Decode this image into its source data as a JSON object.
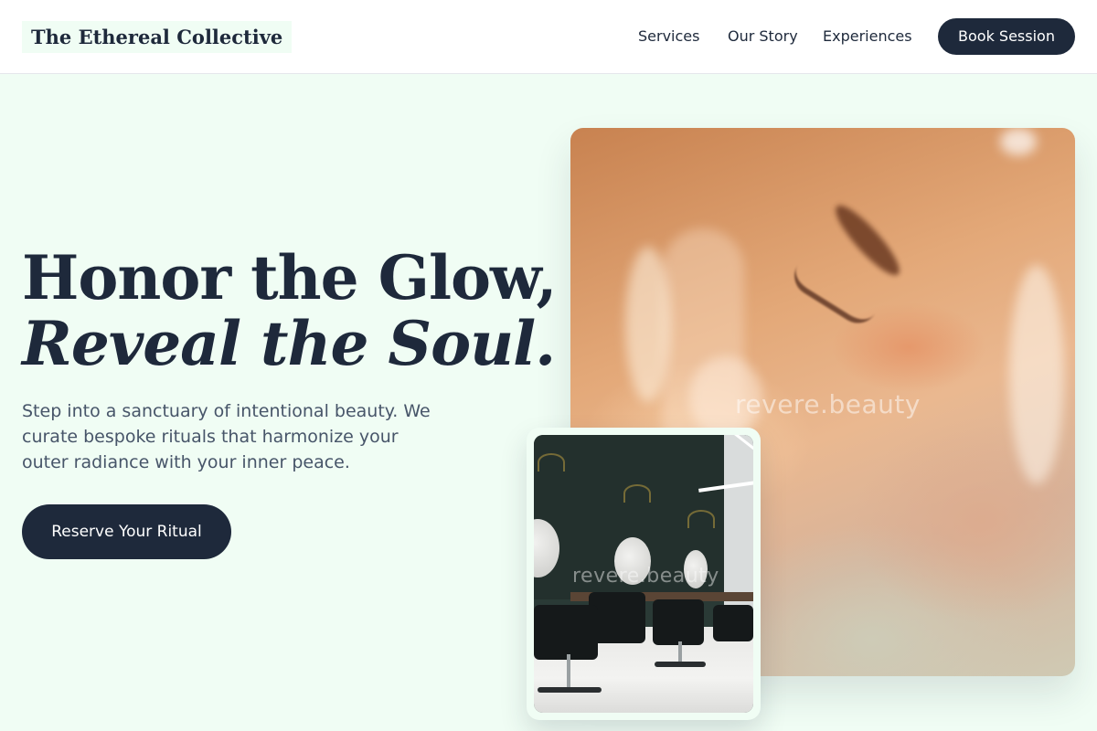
{
  "header": {
    "logo": "The Ethereal Collective",
    "nav": {
      "services": "Services",
      "our_story": "Our Story",
      "experiences": "Experiences"
    },
    "cta_label": "Book Session"
  },
  "hero": {
    "headline_line1": "Honor the Glow,",
    "headline_line2": "Reveal the Soul.",
    "subtext": "Step into a sanctuary of intentional beauty. We curate bespoke rituals that harmonize your outer radiance with your inner peace.",
    "cta_label": "Reserve Your Ritual"
  },
  "images": {
    "portrait_watermark": "revere.beauty",
    "salon_watermark": "revere.beauty"
  },
  "colors": {
    "background": "#f0fdf4",
    "primary": "#1e293b",
    "text_muted": "#475569"
  }
}
